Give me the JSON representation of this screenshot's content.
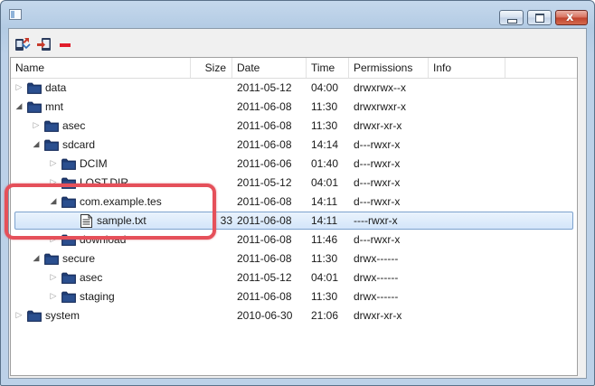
{
  "window": {
    "controls": {
      "minimize_icon": "minimize-icon",
      "maximize_icon": "maximize-icon",
      "close_label": "x"
    }
  },
  "toolbar": {
    "buttons": [
      {
        "name": "pull-file-button",
        "icon": "pull-from-device-icon"
      },
      {
        "name": "push-file-button",
        "icon": "push-to-device-icon"
      },
      {
        "name": "delete-button",
        "icon": "delete-icon",
        "color": "#e11c2a"
      }
    ]
  },
  "table": {
    "columns": [
      "Name",
      "Size",
      "Date",
      "Time",
      "Permissions",
      "Info"
    ],
    "selected_row_index": 7,
    "rows": [
      {
        "depth": 0,
        "expanded": false,
        "type": "folder",
        "name": "data",
        "size": "",
        "date": "2011-05-12",
        "time": "04:00",
        "permissions": "drwxrwx--x",
        "info": ""
      },
      {
        "depth": 0,
        "expanded": true,
        "type": "folder",
        "name": "mnt",
        "size": "",
        "date": "2011-06-08",
        "time": "11:30",
        "permissions": "drwxrwxr-x",
        "info": ""
      },
      {
        "depth": 1,
        "expanded": false,
        "type": "folder",
        "name": "asec",
        "size": "",
        "date": "2011-06-08",
        "time": "11:30",
        "permissions": "drwxr-xr-x",
        "info": ""
      },
      {
        "depth": 1,
        "expanded": true,
        "type": "folder",
        "name": "sdcard",
        "size": "",
        "date": "2011-06-08",
        "time": "14:14",
        "permissions": "d---rwxr-x",
        "info": ""
      },
      {
        "depth": 2,
        "expanded": false,
        "type": "folder",
        "name": "DCIM",
        "size": "",
        "date": "2011-06-06",
        "time": "01:40",
        "permissions": "d---rwxr-x",
        "info": ""
      },
      {
        "depth": 2,
        "expanded": false,
        "type": "folder",
        "name": "LOST.DIR",
        "size": "",
        "date": "2011-05-12",
        "time": "04:01",
        "permissions": "d---rwxr-x",
        "info": ""
      },
      {
        "depth": 2,
        "expanded": true,
        "type": "folder",
        "name": "com.example.tes",
        "size": "",
        "date": "2011-06-08",
        "time": "14:11",
        "permissions": "d---rwxr-x",
        "info": ""
      },
      {
        "depth": 3,
        "expanded": null,
        "type": "file",
        "name": "sample.txt",
        "size": "33",
        "date": "2011-06-08",
        "time": "14:11",
        "permissions": "----rwxr-x",
        "info": ""
      },
      {
        "depth": 2,
        "expanded": false,
        "type": "folder",
        "name": "download",
        "size": "",
        "date": "2011-06-08",
        "time": "11:46",
        "permissions": "d---rwxr-x",
        "info": ""
      },
      {
        "depth": 1,
        "expanded": true,
        "type": "folder",
        "name": "secure",
        "size": "",
        "date": "2011-06-08",
        "time": "11:30",
        "permissions": "drwx------",
        "info": ""
      },
      {
        "depth": 2,
        "expanded": false,
        "type": "folder",
        "name": "asec",
        "size": "",
        "date": "2011-05-12",
        "time": "04:01",
        "permissions": "drwx------",
        "info": ""
      },
      {
        "depth": 2,
        "expanded": false,
        "type": "folder",
        "name": "staging",
        "size": "",
        "date": "2011-06-08",
        "time": "11:30",
        "permissions": "drwx------",
        "info": ""
      },
      {
        "depth": 0,
        "expanded": false,
        "type": "folder",
        "name": "system",
        "size": "",
        "date": "2010-06-30",
        "time": "21:06",
        "permissions": "drwxr-xr-x",
        "info": ""
      }
    ]
  },
  "annotation": {
    "color": "#e5505a"
  },
  "colors": {
    "folder": "#1f3c73",
    "selection_border": "#7da2ce",
    "titlebar": "#b3cbe4"
  }
}
